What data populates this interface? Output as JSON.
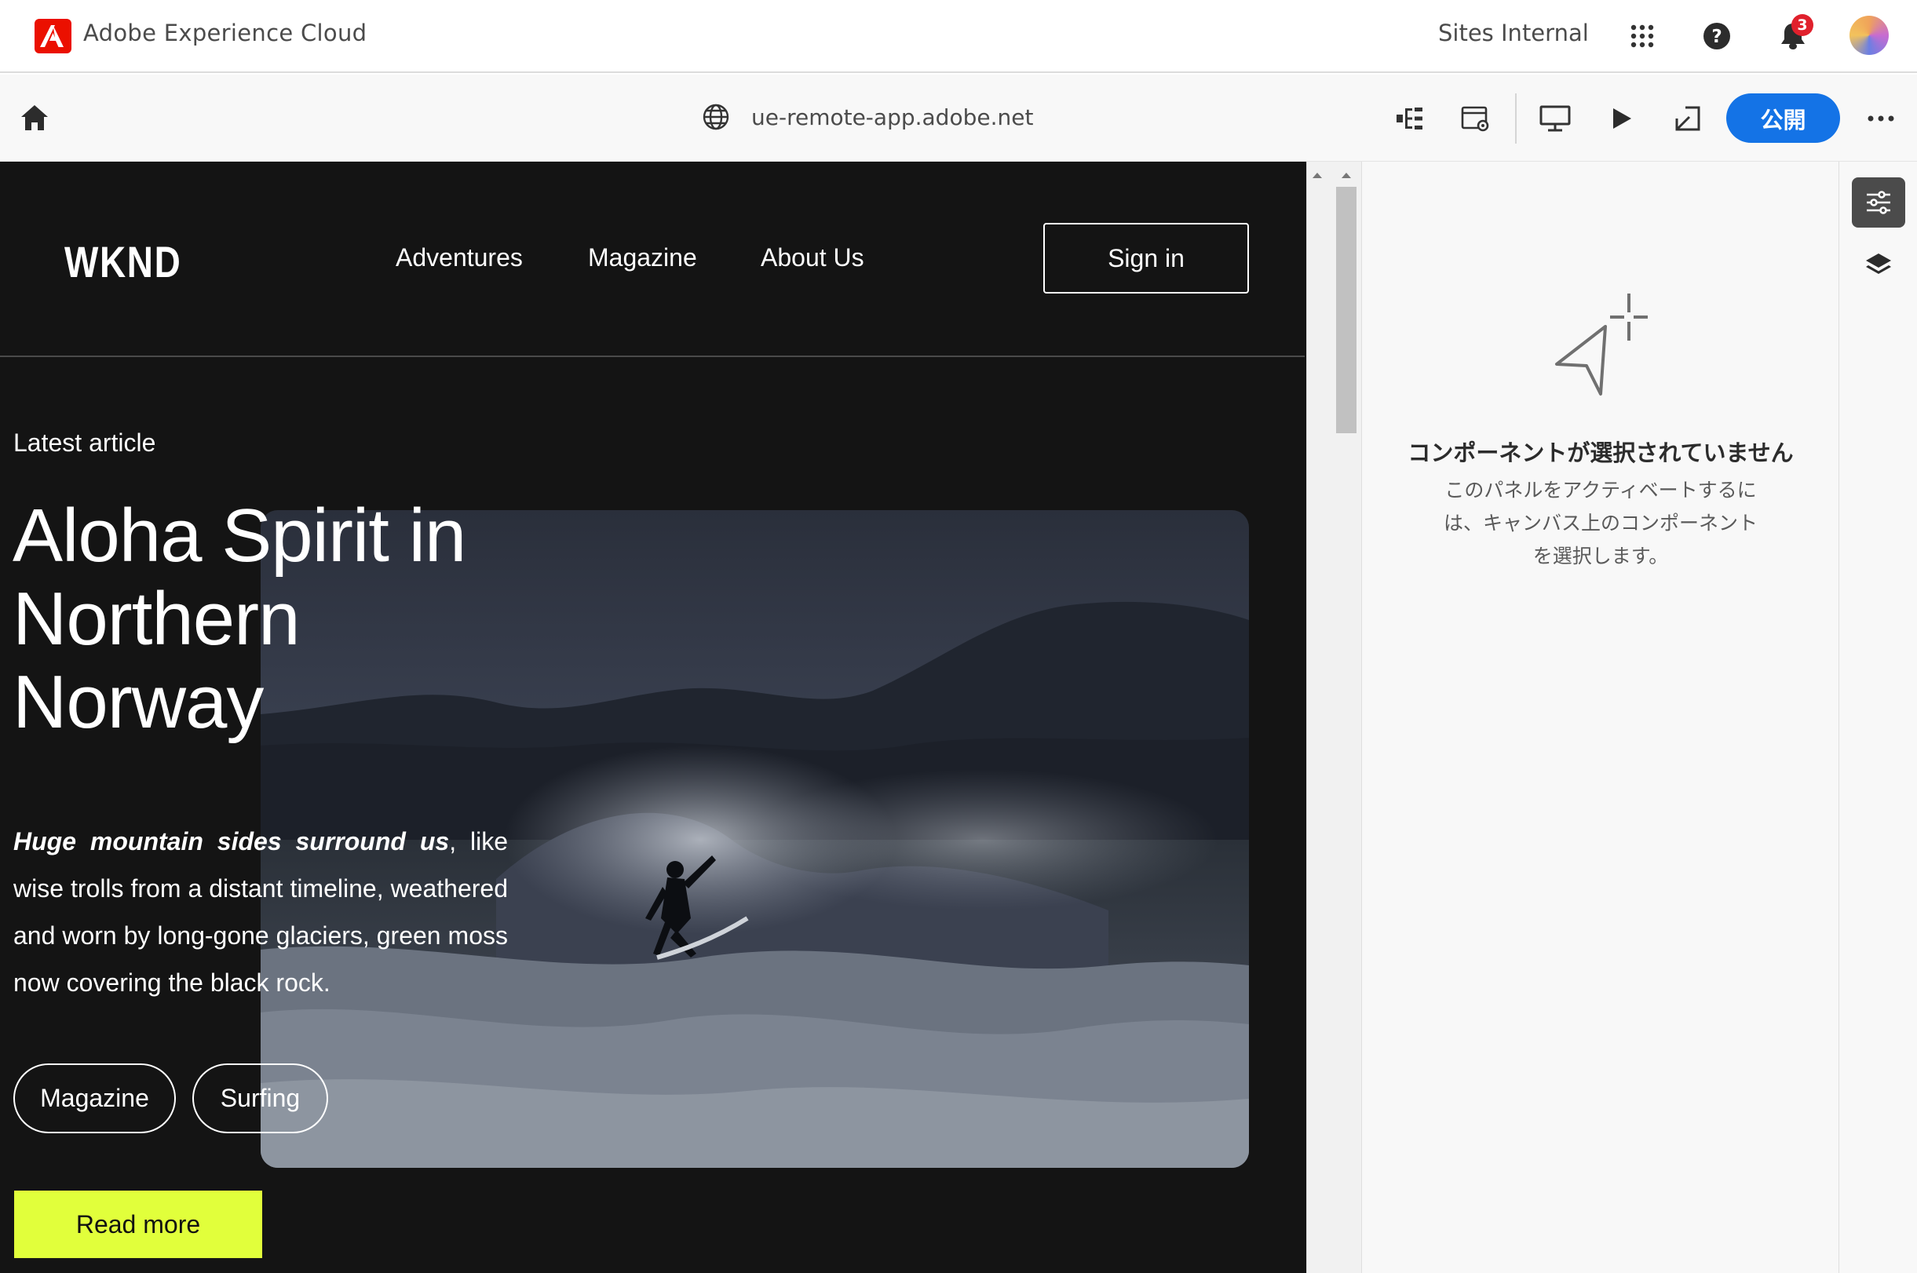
{
  "shell": {
    "app_title": "Adobe Experience Cloud",
    "org_name": "Sites Internal",
    "notification_count": "3",
    "brand_color": "#EB1000"
  },
  "toolbar": {
    "url": "ue-remote-app.adobe.net",
    "publish_label": "公開",
    "publish_color": "#1473E6"
  },
  "site": {
    "logo": "WKND",
    "nav": [
      "Adventures",
      "Magazine",
      "About Us"
    ],
    "signin_label": "Sign in",
    "eyebrow": "Latest article",
    "headline": "Aloha Spirit in Northern Norway",
    "desc_bold": "Huge mountain sides surround us",
    "desc_rest": ", like wise trolls from a distant timeline, weathered and worn by long-gone glaciers, green moss now covering the black rock.",
    "tags": [
      "Magazine",
      "Surfing"
    ],
    "read_more": "Read more",
    "accent_color": "#E1FF3B"
  },
  "panel": {
    "empty_title": "コンポーネントが選択されていません",
    "empty_desc": "このパネルをアクティベートするには、キャンバス上のコンポーネントを選択します。"
  },
  "rail": {
    "items": [
      {
        "icon": "properties-icon",
        "selected": true
      },
      {
        "icon": "layers-icon",
        "selected": false
      }
    ]
  }
}
